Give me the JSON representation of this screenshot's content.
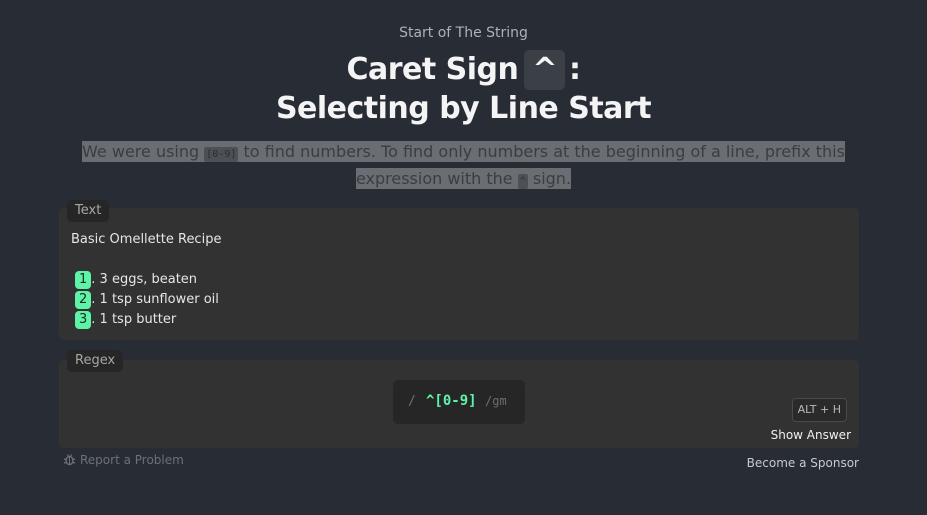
{
  "header": {
    "subtitle": "Start of The String",
    "title_part1": "Caret Sign",
    "title_key": "^",
    "title_colon": ":",
    "title_line2": "Selecting by Line Start"
  },
  "description": {
    "part1": "We were using",
    "code1": "[0-9]",
    "part2": "to find numbers. To find only numbers at the beginning of a line, prefix this",
    "part3": "expression with the",
    "code2": "^",
    "part4": "sign."
  },
  "text_panel": {
    "label": "Text",
    "heading": "Basic Omellette Recipe",
    "items": [
      {
        "num": "1",
        "rest": ". 3 eggs, beaten"
      },
      {
        "num": "2",
        "rest": ". 1 tsp sunflower oil"
      },
      {
        "num": "3",
        "rest": ". 1 tsp butter"
      }
    ]
  },
  "regex_panel": {
    "label": "Regex",
    "slash": "/",
    "expression": "^[0-9]",
    "flags": "/gm",
    "hotkey": "ALT + H",
    "show_answer": "Show Answer"
  },
  "footer": {
    "report": "Report a Problem",
    "sponsor": "Become a Sponsor"
  },
  "colors": {
    "background": "#282c34",
    "match_highlight": "#5df4a8",
    "panel": "#323232"
  },
  "icons": {
    "report": "bug-icon"
  }
}
